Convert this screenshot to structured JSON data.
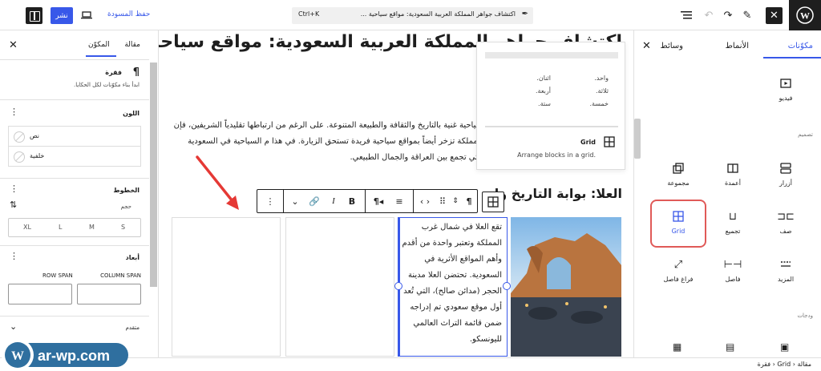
{
  "topbar": {
    "publish": "نشر",
    "save_draft": "حفظ المسودة",
    "command_kbd": "Ctrl+K",
    "document_title": "اكتشاف جواهر المملكة العربية السعودية: مواقع سياحية ..."
  },
  "inserter": {
    "tabs": [
      "مكوّنات",
      "الأنماط",
      "وسائط"
    ],
    "blocks_top": [
      {
        "label": "فيديو",
        "icon": "video-icon"
      }
    ],
    "category_design": "تصميم",
    "blocks": [
      {
        "label": "أزرار",
        "icon": "buttons-icon"
      },
      {
        "label": "أعمدة",
        "icon": "columns-icon"
      },
      {
        "label": "مجموعة",
        "icon": "group-icon"
      },
      {
        "label": "صف",
        "icon": "row-icon"
      },
      {
        "label": "تجميع",
        "icon": "stack-icon"
      },
      {
        "label": "Grid",
        "icon": "grid-icon"
      },
      {
        "label": "المزيد",
        "icon": "more-icon"
      },
      {
        "label": "فاصل",
        "icon": "separator-icon"
      },
      {
        "label": "فراغ فاصل",
        "icon": "spacer-icon"
      }
    ],
    "category_widgets": "ودجات"
  },
  "sidebar": {
    "tabs": [
      "مقالة",
      "المكوّن"
    ],
    "block_name": "فقرة",
    "block_desc": "ابدأ بناء مكوّنات لكل الحكايا.",
    "color_heading": "اللون",
    "color_items": [
      "نص",
      "خلفية"
    ],
    "typography_heading": "الخطوط",
    "size_label": "حجم",
    "sizes": [
      "S",
      "M",
      "L",
      "XL"
    ],
    "dimensions_heading": "أبعاد",
    "column_span": "COLUMN SPAN",
    "row_span": "ROW SPAN",
    "advanced": "متقدم"
  },
  "canvas": {
    "heading_top": "اكتشاف جواهر المملكة العربية السعودية: مواقع سياحية لا",
    "paragraph": "سياحية غنية بالتاريخ والثقافة والطبيعة المتنوعة. على الرغم من ارتباطها تقليدياً الشريفين، فإن المملكة تزخر أيضاً بمواقع سياحية فريدة تستحق الزيارة. في هذا م السياحية في السعودية التي تجمع بين العراقة والجمال الطبيعي.",
    "heading_2": "العلا: بوابة التاريخ وا",
    "column_text": "تقع العلا في شمال غرب المملكة وتعتبر واحدة من أقدم وأهم المواقع الأثرية في السعودية. تحتضن العلا مدينة الحجر (مدائن صالح)، التي تُعد أول موقع سعودي تم إدراجه ضمن قائمة التراث العالمي لليونسكو."
  },
  "popover": {
    "cells": [
      "واحد.",
      "اثنان.",
      "ثلاثة.",
      "أربعة.",
      "خمسة.",
      "ستة."
    ],
    "title": "Grid",
    "desc": "Arrange blocks in a grid."
  },
  "toolbar": {
    "paragraph_icon": "¶",
    "bold": "B",
    "italic": "I"
  },
  "footer": {
    "crumbs": [
      "مقالة",
      "Grid",
      "فقرة"
    ]
  },
  "watermark": "ar-wp.com",
  "colors": {
    "accent": "#3858e9",
    "highlight": "#e05a58",
    "dark": "#1e1e1e"
  }
}
